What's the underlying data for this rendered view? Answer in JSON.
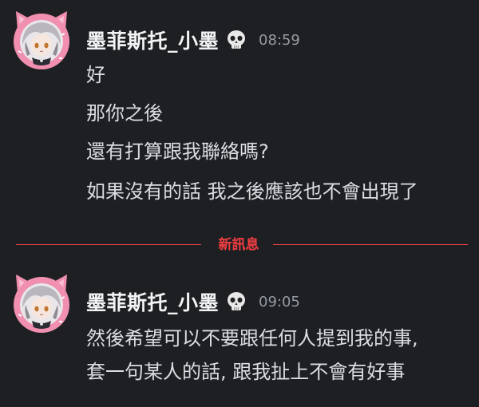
{
  "messages": [
    {
      "username": "墨菲斯托_小墨",
      "badge_icon": "skull-emoji",
      "timestamp": "08:59",
      "lines": [
        "好",
        "那你之後",
        "還有打算跟我聯絡嗎?",
        "如果沒有的話 我之後應該也不會出現了"
      ]
    },
    {
      "username": "墨菲斯托_小墨",
      "badge_icon": "skull-emoji",
      "timestamp": "09:05",
      "lines": [
        "然後希望可以不要跟任何人提到我的事,",
        "套一句某人的話, 跟我扯上不會有好事"
      ]
    }
  ],
  "divider": {
    "label": "新訊息",
    "color": "#f23f43"
  },
  "colors": {
    "background": "#1e1f22",
    "text": "#dbdee1",
    "username": "#f2f3f5",
    "timestamp": "#949ba4",
    "avatar_frame": "#f08fb0"
  }
}
